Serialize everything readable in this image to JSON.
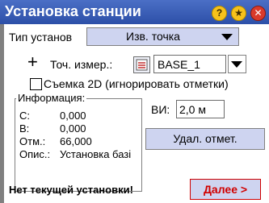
{
  "title": "Установка станции",
  "title_buttons": {
    "help_icon": "?",
    "star_icon": "★",
    "close_icon": "✕"
  },
  "setup_type": {
    "label": "Тип установ",
    "value": "Изв. точка"
  },
  "point": {
    "plus_icon": "+",
    "label": "Точ. измер.:",
    "value": "BASE_1"
  },
  "survey_2d": {
    "label": "Съемка 2D (игнорировать отметки)",
    "checked": false
  },
  "info": {
    "label": "Информация:",
    "rows": [
      {
        "key": "С:",
        "value": "0,000"
      },
      {
        "key": "В:",
        "value": "0,000"
      },
      {
        "key": "Отм.:",
        "value": "66,000"
      },
      {
        "key": "Опис.:",
        "value": "Установка базі"
      }
    ]
  },
  "instrument_height": {
    "label": "ВИ:",
    "value": "2,0 м"
  },
  "delete_button": "Удал. отмет.",
  "status": "Нет текущей установки!",
  "next_button": "Далее >",
  "colors": {
    "title_bar": "#2c4fa8",
    "button_fill": "#ced4f0",
    "next_text": "#d00000"
  }
}
